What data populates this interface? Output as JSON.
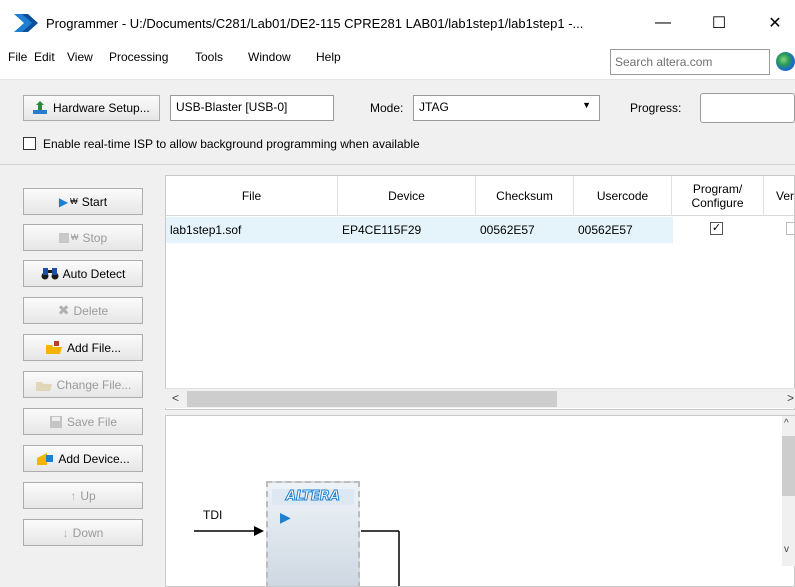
{
  "window": {
    "title": "Programmer - U:/Documents/C281/Lab01/DE2-115 CPRE281 LAB01/lab1step1/lab1step1 -...",
    "minimize_symbol": "—",
    "maximize_symbol": "☐",
    "close_symbol": "✕"
  },
  "menu": {
    "items": [
      "File",
      "Edit",
      "View",
      "Processing",
      "Tools",
      "Window",
      "Help"
    ],
    "search_placeholder": "Search altera.com"
  },
  "toolbar": {
    "hardware_setup_label": "Hardware Setup...",
    "hardware_value": "USB-Blaster [USB-0]",
    "mode_label": "Mode:",
    "mode_value": "JTAG",
    "progress_label": "Progress:",
    "isp_label": "Enable real-time ISP to allow background programming when available",
    "isp_checked": false
  },
  "side_buttons": [
    {
      "label": "Start",
      "enabled": true,
      "icon": "start-icon"
    },
    {
      "label": "Stop",
      "enabled": false,
      "icon": "stop-icon"
    },
    {
      "label": "Auto Detect",
      "enabled": true,
      "icon": "binoculars-icon"
    },
    {
      "label": "Delete",
      "enabled": false,
      "icon": "delete-icon"
    },
    {
      "label": "Add File...",
      "enabled": true,
      "icon": "add-file-icon"
    },
    {
      "label": "Change File...",
      "enabled": false,
      "icon": "change-file-icon"
    },
    {
      "label": "Save File",
      "enabled": false,
      "icon": "save-file-icon"
    },
    {
      "label": "Add Device...",
      "enabled": true,
      "icon": "add-device-icon"
    },
    {
      "label": "Up",
      "enabled": false,
      "icon": "up-icon"
    },
    {
      "label": "Down",
      "enabled": false,
      "icon": "down-icon"
    }
  ],
  "table": {
    "columns": [
      "File",
      "Device",
      "Checksum",
      "Usercode",
      "Program/\nConfigure",
      "Ver"
    ],
    "rows": [
      {
        "file": "lab1step1.sof",
        "device": "EP4CE115F29",
        "checksum": "00562E57",
        "usercode": "00562E57",
        "program": true,
        "verify": false
      }
    ]
  },
  "chain": {
    "tdi_label": "TDI",
    "chip_brand": "ALTERA"
  },
  "colors": {
    "selected_row": "#e5f3fb",
    "altera_blue": "#1e7fd1"
  }
}
